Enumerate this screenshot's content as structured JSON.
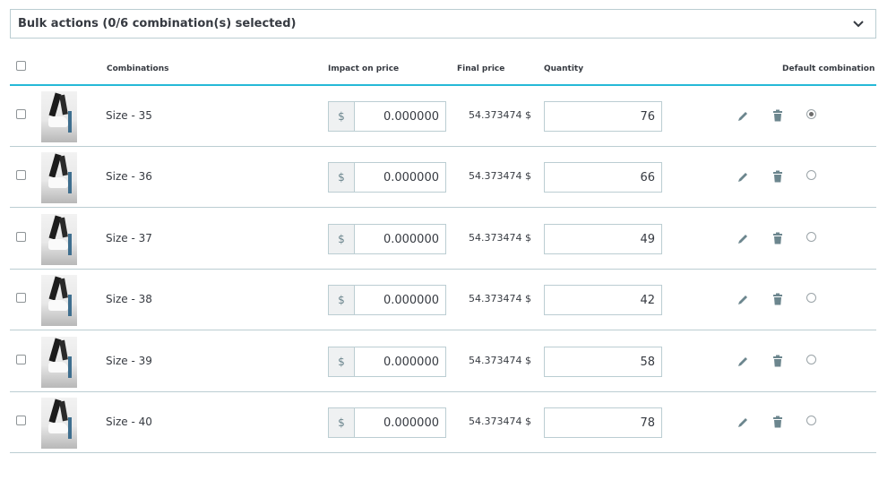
{
  "bulk": {
    "label": "Bulk actions (0/6 combination(s) selected)",
    "icon": "chevron-down-icon"
  },
  "columns": {
    "combinations": "Combinations",
    "impact": "Impact on price",
    "final": "Final price",
    "quantity": "Quantity",
    "default": "Default combination"
  },
  "rows": [
    {
      "name": "Size - 35",
      "currency": "$",
      "impact": "0.000000",
      "final": "54.373474 $",
      "quantity": "76",
      "default": true
    },
    {
      "name": "Size - 36",
      "currency": "$",
      "impact": "0.000000",
      "final": "54.373474 $",
      "quantity": "66",
      "default": false
    },
    {
      "name": "Size - 37",
      "currency": "$",
      "impact": "0.000000",
      "final": "54.373474 $",
      "quantity": "49",
      "default": false
    },
    {
      "name": "Size - 38",
      "currency": "$",
      "impact": "0.000000",
      "final": "54.373474 $",
      "quantity": "42",
      "default": false
    },
    {
      "name": "Size - 39",
      "currency": "$",
      "impact": "0.000000",
      "final": "54.373474 $",
      "quantity": "58",
      "default": false
    },
    {
      "name": "Size - 40",
      "currency": "$",
      "impact": "0.000000",
      "final": "54.373474 $",
      "quantity": "78",
      "default": false
    }
  ],
  "colors": {
    "accent": "#25b9d7",
    "border": "#bbcdd2",
    "text": "#363a41",
    "icon": "#6c868e"
  }
}
